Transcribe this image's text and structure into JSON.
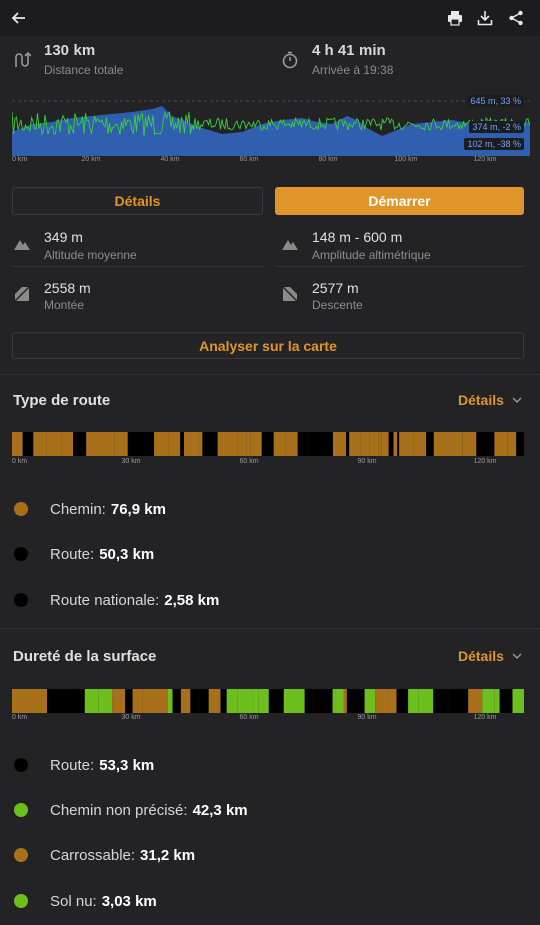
{
  "toolbar": {
    "back_icon": "arrow-left-icon",
    "print_icon": "print-icon",
    "download_icon": "download-icon",
    "share_icon": "share-icon"
  },
  "summary": {
    "distance_value": "130",
    "distance_unit": "km",
    "distance_label": "Distance totale",
    "duration_hours": "4 h 41",
    "duration_unit": "min",
    "arrival_label": "Arrivée à 19:38"
  },
  "elevation_chart": {
    "tags": [
      "645 m, 33 %",
      "374 m, -2 %",
      "102 m, -38 %"
    ],
    "ticks": [
      "0 km",
      "20 km",
      "40 km",
      "60 km",
      "80 km",
      "100 km",
      "120 km"
    ]
  },
  "buttons": {
    "details": "Détails",
    "start": "Démarrer",
    "analyze": "Analyser sur la carte"
  },
  "stats": {
    "avg_alt_value": "349 m",
    "avg_alt_label": "Altitude moyenne",
    "amplitude_value": "148 m - 600 m",
    "amplitude_label": "Amplitude altimétrique",
    "ascent_value": "2558 m",
    "ascent_label": "Montée",
    "descent_value": "2577 m",
    "descent_label": "Descente"
  },
  "road_type": {
    "title": "Type de route",
    "details": "Détails",
    "ticks": [
      "0 km",
      "30 km",
      "60 km",
      "90 km",
      "120 km"
    ],
    "items": [
      {
        "label": "Chemin:",
        "value": "76,9 km",
        "color": "#a8701a"
      },
      {
        "label": "Route:",
        "value": "50,3 km",
        "color": "#000000"
      },
      {
        "label": "Route nationale:",
        "value": "2,58 km",
        "color": "#000000"
      }
    ]
  },
  "surface": {
    "title": "Dureté de la surface",
    "details": "Détails",
    "ticks": [
      "0 km",
      "30 km",
      "60 km",
      "90 km",
      "120 km"
    ],
    "items": [
      {
        "label": "Route:",
        "value": "53,3 km",
        "color": "#000000"
      },
      {
        "label": "Chemin non précisé:",
        "value": "42,3 km",
        "color": "#6cbf1d"
      },
      {
        "label": "Carrossable:",
        "value": "31,2 km",
        "color": "#a8701a"
      },
      {
        "label": "Sol nu:",
        "value": "3,03 km",
        "color": "#6cbf1d"
      }
    ]
  },
  "colors": {
    "accent": "#e0952a",
    "elevation_fill": "#2f5fae",
    "slope_line": "#3ad13a",
    "chemin": "#a8701a",
    "route": "#000000",
    "green": "#6cbf1d"
  }
}
